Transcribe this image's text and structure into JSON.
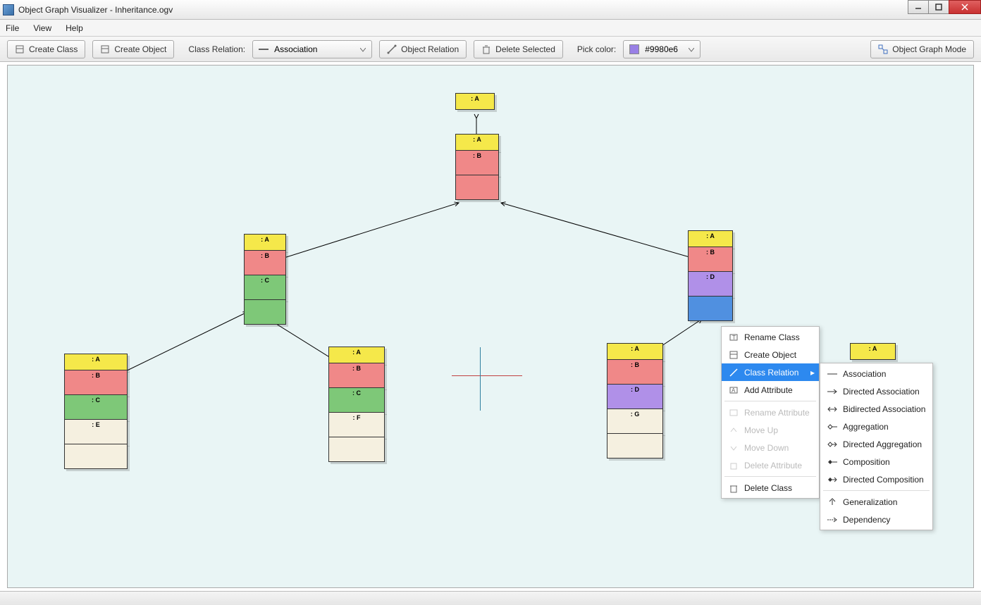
{
  "window": {
    "title": "Object Graph Visualizer - Inheritance.ogv"
  },
  "menubar": {
    "file": "File",
    "view": "View",
    "help": "Help"
  },
  "toolbar": {
    "create_class": "Create Class",
    "create_object": "Create Object",
    "class_relation_label": "Class Relation:",
    "class_relation_value": "Association",
    "object_relation": "Object Relation",
    "delete_selected": "Delete Selected",
    "pick_color_label": "Pick color:",
    "pick_color_value": "#9980e6",
    "mode_button": "Object Graph Mode"
  },
  "context_menu": {
    "rename_class": "Rename Class",
    "create_object": "Create Object",
    "class_relation": "Class Relation",
    "add_attribute": "Add Attribute",
    "rename_attribute": "Rename Attribute",
    "move_up": "Move Up",
    "move_down": "Move Down",
    "delete_attribute": "Delete Attribute",
    "delete_class": "Delete Class"
  },
  "relation_submenu": {
    "association": "Association",
    "directed_association": "Directed Association",
    "bidirected_association": "Bidirected Association",
    "aggregation": "Aggregation",
    "directed_aggregation": "Directed Aggregation",
    "composition": "Composition",
    "directed_composition": "Directed Composition",
    "generalization": "Generalization",
    "dependency": "Dependency"
  },
  "labels": {
    "A": ": A",
    "B": ": B",
    "C": ": C",
    "D": ": D",
    "E": ": E",
    "F": ": F",
    "G": ": G"
  }
}
